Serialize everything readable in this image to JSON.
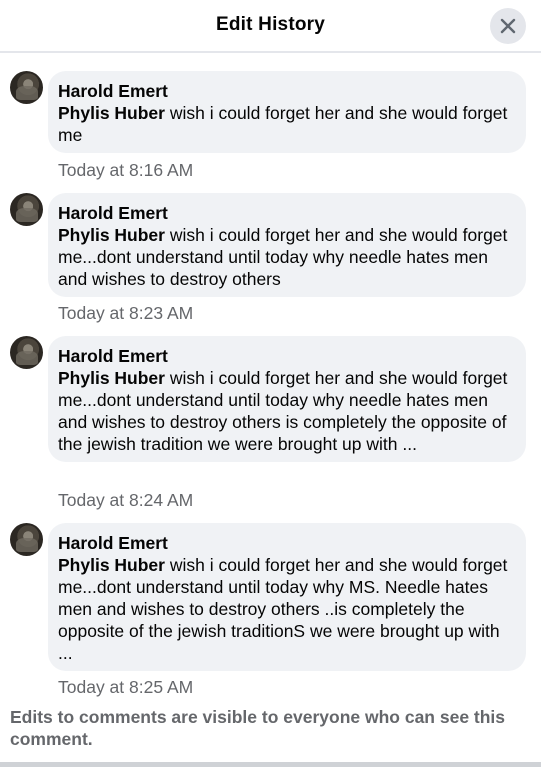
{
  "dialog": {
    "title": "Edit History"
  },
  "entries": [
    {
      "author": "Harold Emert",
      "tag": "Phylis Huber",
      "text": " wish i could forget her and she would forget me",
      "time": "Today at 8:16 AM"
    },
    {
      "author": "Harold Emert",
      "tag": "Phylis Huber",
      "text": " wish i could forget her and she would forget me...dont understand until today why needle hates men and wishes to destroy others",
      "time": "Today at 8:23 AM"
    },
    {
      "author": "Harold Emert",
      "tag": "Phylis Huber",
      "text": " wish i could forget her and she would forget me...dont understand until today why needle hates men and wishes to destroy others is completely the opposite of the jewish tradition we were brought up with ...",
      "time": "Today at 8:24 AM"
    },
    {
      "author": "Harold Emert",
      "tag": "Phylis Huber",
      "text": " wish i could forget her and she would forget me...dont understand until today why MS. Needle hates men and wishes to destroy others ..is completely the opposite of the jewish traditionS we were brought up with ...",
      "time": "Today at 8:25 AM"
    }
  ],
  "footer": {
    "note": "Edits to comments are visible to everyone who can see this comment."
  }
}
